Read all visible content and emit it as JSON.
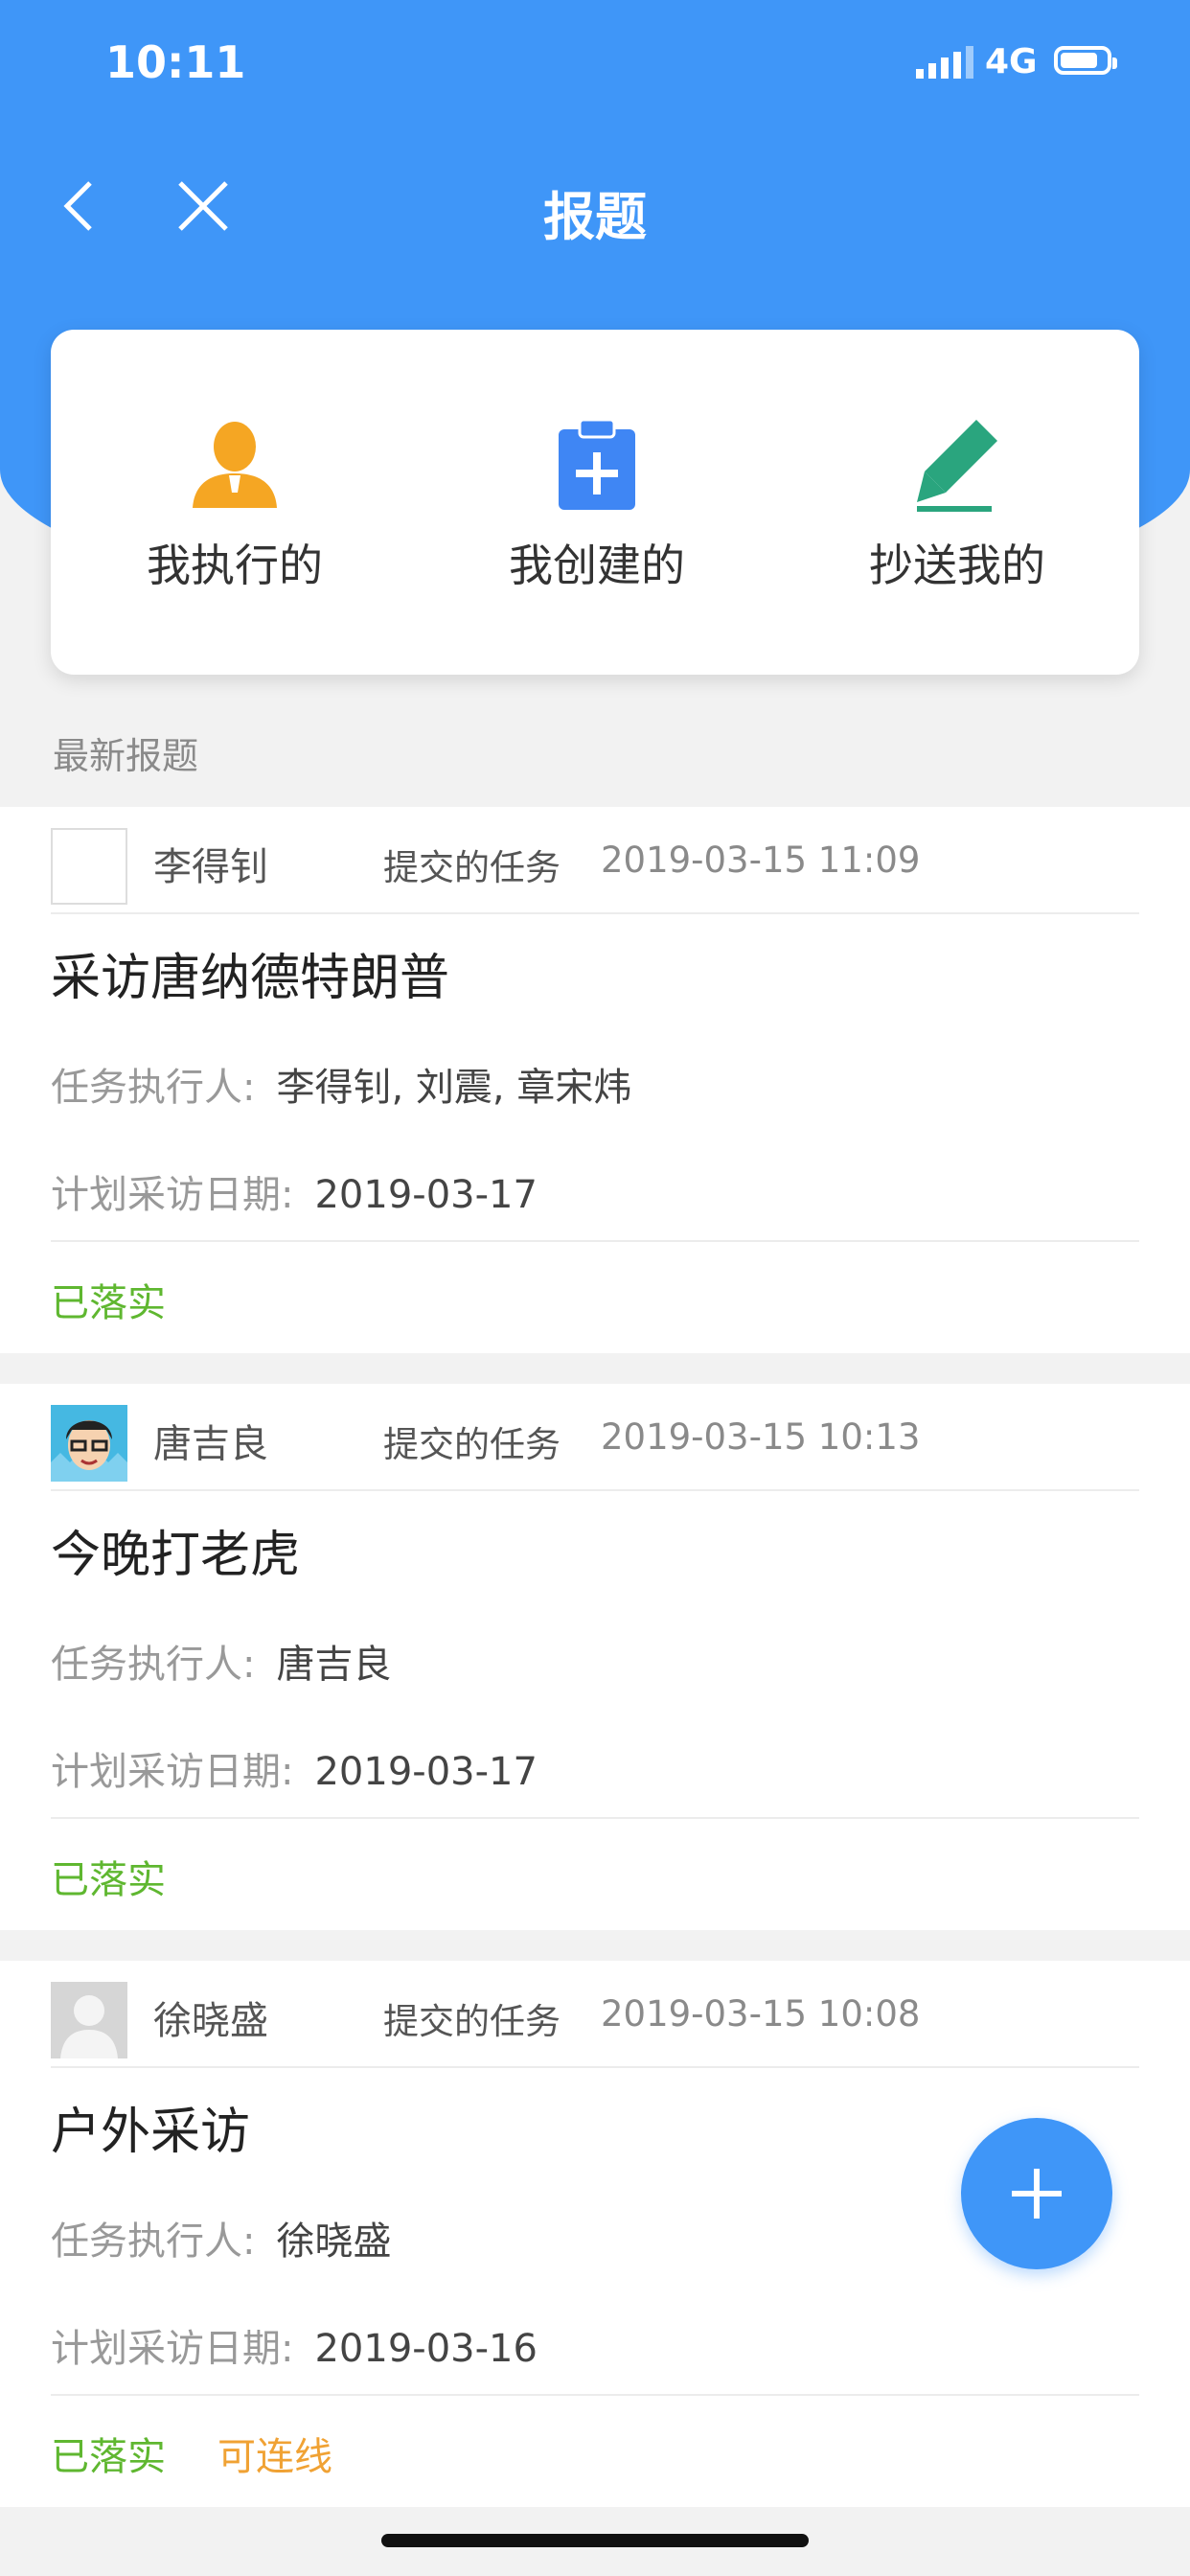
{
  "status_bar": {
    "time": "10:11",
    "network": "4G"
  },
  "nav": {
    "title": "报题"
  },
  "quick_actions": [
    {
      "label": "我执行的",
      "icon": "person-icon",
      "color": "#f5a623"
    },
    {
      "label": "我创建的",
      "icon": "clipboard-add-icon",
      "color": "#3f86f4"
    },
    {
      "label": "抄送我的",
      "icon": "pencil-icon",
      "color": "#2aa57e"
    }
  ],
  "section": {
    "title": "最新报题"
  },
  "items": [
    {
      "user": "李得钊",
      "action": "提交的任务",
      "time": "2019-03-15 11:09",
      "title": "采访唐纳德特朗普",
      "executor_label": "任务执行人:",
      "executor": "李得钊, 刘震, 章宋炜",
      "plan_label": "计划采访日期:",
      "plan_date": "2019-03-17",
      "tags": [
        "已落实"
      ]
    },
    {
      "user": "唐吉良",
      "action": "提交的任务",
      "time": "2019-03-15 10:13",
      "title": "今晚打老虎",
      "executor_label": "任务执行人:",
      "executor": "唐吉良",
      "plan_label": "计划采访日期:",
      "plan_date": "2019-03-17",
      "tags": [
        "已落实"
      ]
    },
    {
      "user": "徐晓盛",
      "action": "提交的任务",
      "time": "2019-03-15 10:08",
      "title": "户外采访",
      "executor_label": "任务执行人:",
      "executor": "徐晓盛",
      "plan_label": "计划采访日期:",
      "plan_date": "2019-03-16",
      "tags": [
        "已落实",
        "可连线"
      ]
    }
  ],
  "colors": {
    "primary": "#3f96f8",
    "status_done": "#5fb730",
    "status_live": "#f0a234"
  }
}
